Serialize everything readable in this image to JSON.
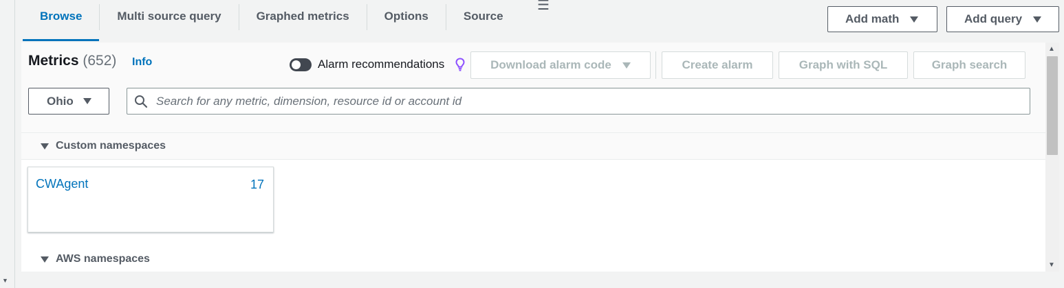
{
  "tabs": [
    {
      "label": "Browse",
      "active": true
    },
    {
      "label": "Multi source query",
      "active": false
    },
    {
      "label": "Graphed metrics",
      "active": false
    },
    {
      "label": "Options",
      "active": false
    },
    {
      "label": "Source",
      "active": false
    }
  ],
  "toolbar": {
    "add_math_label": "Add math",
    "add_query_label": "Add query"
  },
  "metrics": {
    "title": "Metrics",
    "count": "(652)",
    "info_label": "Info"
  },
  "alarm_recommendations": {
    "label": "Alarm recommendations",
    "enabled": false
  },
  "actions": {
    "download_alarm_code": "Download alarm code",
    "create_alarm": "Create alarm",
    "graph_with_sql": "Graph with SQL",
    "graph_search": "Graph search"
  },
  "region": {
    "selected": "Ohio"
  },
  "search": {
    "placeholder": "Search for any metric, dimension, resource id or account id",
    "value": ""
  },
  "namespaces": {
    "custom_label": "Custom namespaces",
    "custom_items": [
      {
        "name": "CWAgent",
        "count": "17"
      }
    ],
    "aws_label": "AWS namespaces"
  },
  "icons": {
    "menu": "menu-icon",
    "bulb": "lightbulb-icon",
    "search": "search-icon"
  },
  "colors": {
    "accent": "#0073bb",
    "bulb": "#8c4fff",
    "toggle_off": "#414750"
  }
}
